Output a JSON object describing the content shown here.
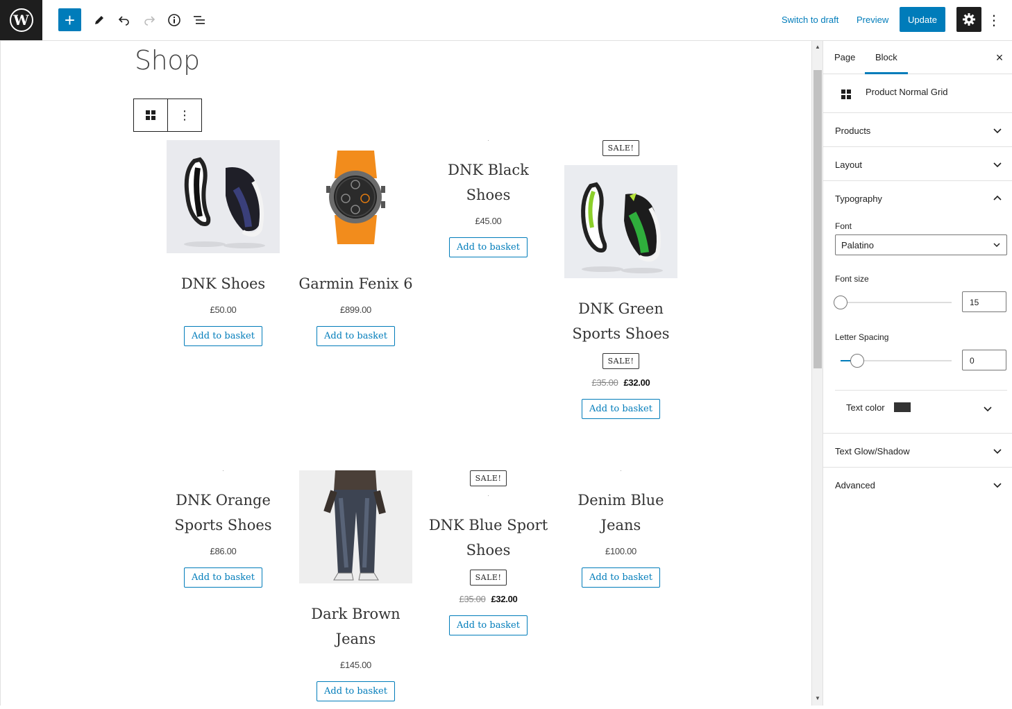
{
  "toolbar": {
    "logo": "W",
    "add_icon": "+",
    "switch_draft": "Switch to draft",
    "preview": "Preview",
    "update": "Update",
    "more_icon": "⋮"
  },
  "canvas": {
    "page_title": "Shop",
    "block_more": "⋮"
  },
  "products": [
    {
      "name": "DNK Shoes",
      "price": "£50.00",
      "button": "Add to basket",
      "image": "shoes-image"
    },
    {
      "name": "Garmin Fenix 6",
      "price": "£899.00",
      "button": "Add to basket",
      "image": "watch-image"
    },
    {
      "name": "DNK Black Shoes",
      "price": "£45.00",
      "button": "Add to basket",
      "image": ""
    },
    {
      "name": "DNK Green Sports Shoes",
      "sale": "SALE!",
      "old_price": "£35.00",
      "price": "£32.00",
      "button": "Add to basket",
      "image": "green-shoes-image"
    },
    {
      "name": "DNK Orange Sports Shoes",
      "price": "£86.00",
      "button": "Add to basket",
      "image": ""
    },
    {
      "name": "Dark Brown Jeans",
      "price": "£145.00",
      "button": "Add to basket",
      "image": "jeans-image"
    },
    {
      "name": "DNK Blue Sport Shoes",
      "sale": "SALE!",
      "old_price": "£35.00",
      "price": "£32.00",
      "button": "Add to basket",
      "image": ""
    },
    {
      "name": "Denim Blue Jeans",
      "price": "£100.00",
      "button": "Add to basket",
      "image": ""
    }
  ],
  "sidebar": {
    "tabs": [
      "Page",
      "Block"
    ],
    "active_tab": "Block",
    "close_icon": "×",
    "block_name": "Product Normal Grid",
    "panels": [
      "Products",
      "Layout",
      "Typography",
      "Text Glow/Shadow",
      "Advanced"
    ],
    "typography": {
      "font_label": "Font",
      "font_value": "Palatino",
      "font_size_label": "Font size",
      "font_size_value": "15",
      "font_size_slider": 0.0,
      "letter_spacing_label": "Letter Spacing",
      "letter_spacing_value": "0",
      "letter_spacing_slider": 0.15,
      "text_color_label": "Text color",
      "text_color": "#333333"
    }
  },
  "colors": {
    "accent": "#007cba",
    "dark": "#1e1e1e"
  }
}
